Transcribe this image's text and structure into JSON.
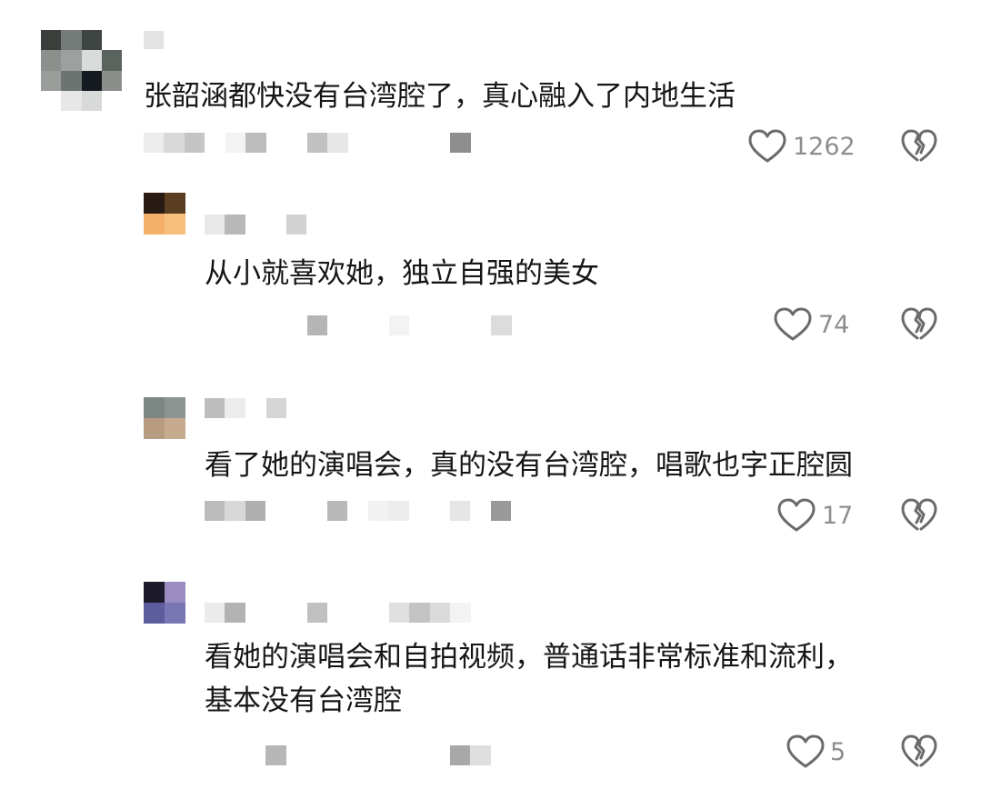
{
  "colors": {
    "text": "#161616",
    "count": "#8e8e8e",
    "icon_stroke": "#6b6b6b"
  },
  "comments": [
    {
      "text": "张韶涵都快没有台湾腔了，真心融入了内地生活",
      "likes": "1262",
      "like_icon": "heart-outline-icon",
      "dislike_icon": "broken-heart-icon"
    },
    {
      "text": "从小就喜欢她，独立自强的美女",
      "likes": "74",
      "like_icon": "heart-outline-icon",
      "dislike_icon": "broken-heart-icon"
    },
    {
      "text": "看了她的演唱会，真的没有台湾腔，唱歌也字正腔圆",
      "likes": "17",
      "like_icon": "heart-outline-icon",
      "dislike_icon": "broken-heart-icon"
    },
    {
      "text_lines": [
        "看她的演唱会和自拍视频，普通话非常标准和流利，",
        "基本没有台湾腔"
      ],
      "likes": "5",
      "like_icon": "heart-outline-icon",
      "dislike_icon": "broken-heart-icon"
    }
  ]
}
